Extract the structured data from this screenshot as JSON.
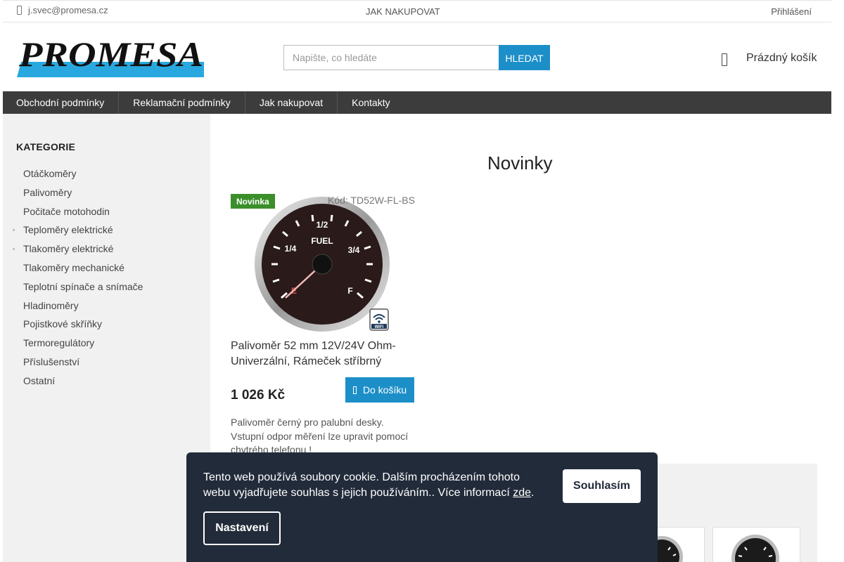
{
  "topbar": {
    "email": "j.svec@promesa.cz",
    "how_to_buy": "JAK NAKUPOVAT",
    "login": "Přihlášení"
  },
  "header": {
    "logo_text": "PROMESA",
    "search_placeholder": "Napište, co hledáte",
    "search_button": "HLEDAT",
    "cart_label": "Prázdný košík"
  },
  "nav": {
    "items": [
      {
        "label": "Obchodní podmínky"
      },
      {
        "label": "Reklamační podmínky"
      },
      {
        "label": "Jak nakupovat"
      },
      {
        "label": "Kontakty"
      }
    ]
  },
  "sidebar": {
    "title": "KATEGORIE",
    "items": [
      {
        "label": "Otáčkoměry",
        "expandable": false
      },
      {
        "label": "Palivoměry",
        "expandable": false
      },
      {
        "label": "Počitače motohodin",
        "expandable": false
      },
      {
        "label": "Teploměry elektrické",
        "expandable": true
      },
      {
        "label": "Tlakoměry elektrické",
        "expandable": true
      },
      {
        "label": "Tlakoměry mechanické",
        "expandable": false
      },
      {
        "label": "Teplotní spínače a snímače",
        "expandable": false
      },
      {
        "label": "Hladinoměry",
        "expandable": false
      },
      {
        "label": "Pojistkové skříňky",
        "expandable": false
      },
      {
        "label": "Termoregulátory",
        "expandable": false
      },
      {
        "label": "Příslušenství",
        "expandable": false
      },
      {
        "label": "Ostatní",
        "expandable": false
      }
    ]
  },
  "main": {
    "title": "Novinky",
    "product": {
      "badge": "Novinka",
      "code": "Kód: TD52W-FL-BS",
      "gauge_labels": [
        "1/2",
        "1/4",
        "3/4",
        "FUEL",
        "E",
        "F"
      ],
      "wifi_label": "WiFi",
      "name": "Palivoměr 52 mm 12V/24V Ohm-Univerzální, Rámeček stříbrný",
      "price": "1 026 Kč",
      "add_to_cart": "Do košíku",
      "description": "Palivoměr černý pro palubní desky. Vstupní odpor měření lze upravit pomocí chytrého telefonu !"
    }
  },
  "cookie": {
    "text": "Tento web používá soubory cookie. Dalším procházením tohoto webu vyjadřujete souhlas s jejich používáním.. Více informací",
    "link": "zde",
    "agree": "Souhlasím",
    "settings": "Nastavení"
  },
  "colors": {
    "accent": "#1d8fc8",
    "nav_bg": "#3c3c3c",
    "badge_green": "#3b8f2a",
    "cookie_bg": "#222b3a",
    "sidebar_bg": "#f1f1f1"
  }
}
